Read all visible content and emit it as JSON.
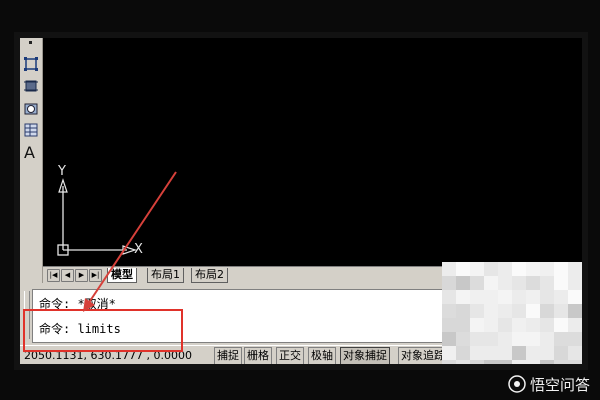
{
  "toolbar": {
    "icons": [
      "dot-icon",
      "rectangle-icon",
      "rectangle-icon",
      "region-icon",
      "table-icon",
      "text-icon"
    ],
    "text_tool_label": "A"
  },
  "canvas": {
    "ucs_x_label": "X",
    "ucs_y_label": "Y"
  },
  "tabs": {
    "items": [
      "模型",
      "布局1",
      "布局2"
    ],
    "active": "模型",
    "nav_buttons": [
      "first",
      "prev",
      "next",
      "last"
    ]
  },
  "command_window": {
    "lines": [
      "命令: *取消*",
      "命令: limits"
    ]
  },
  "status_bar": {
    "coordinates": "2050.1131, 630.1777 , 0.0000",
    "toggles": [
      "捕捉",
      "栅格",
      "正交",
      "极轴",
      "对象捕捉",
      "对象追踪"
    ]
  },
  "annotation": {
    "highlight_color": "#e0322a",
    "arrow_color": "#d6403a"
  },
  "watermark": {
    "text": "悟空问答"
  }
}
